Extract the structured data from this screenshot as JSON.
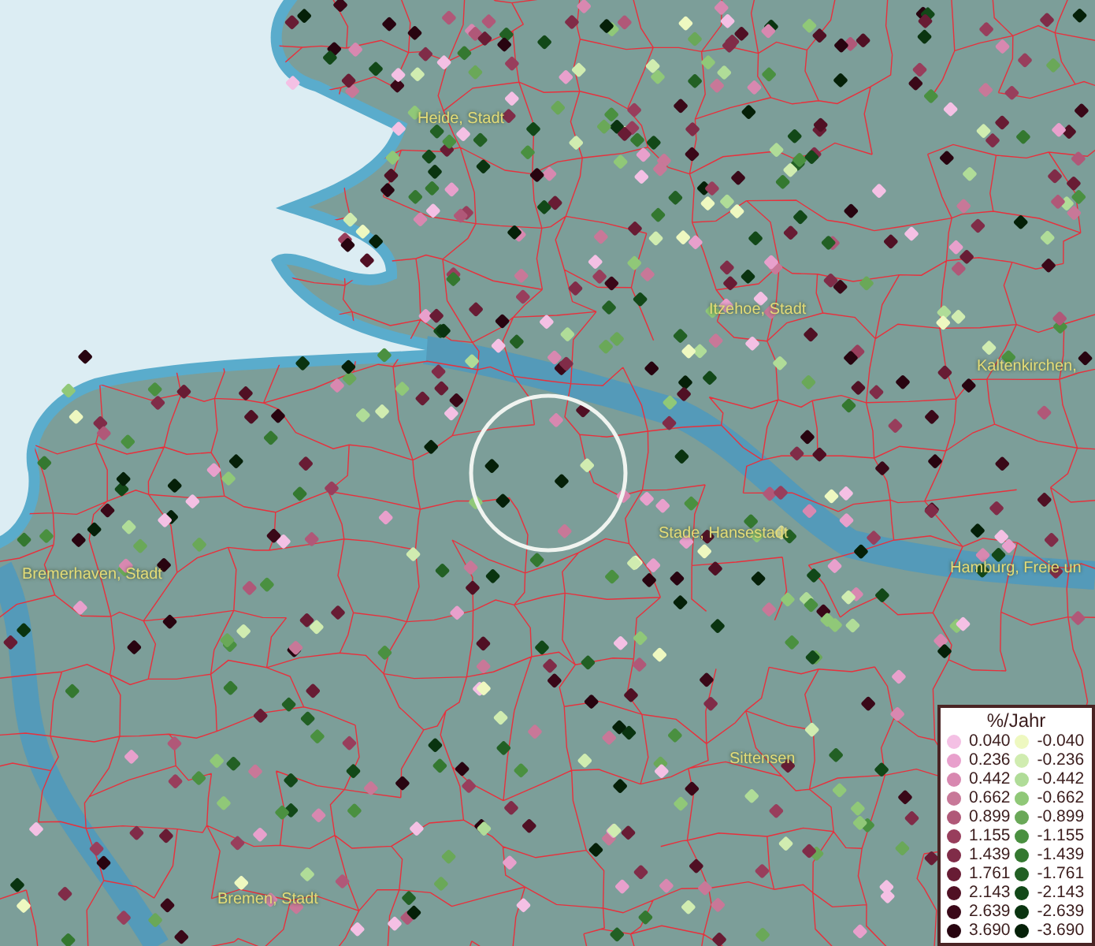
{
  "map": {
    "place_labels": [
      {
        "text": "Heide, Stadt"
      },
      {
        "text": "Itzehoe, Stadt"
      },
      {
        "text": "Kaltenkirchen,"
      },
      {
        "text": "Stade, Hansestadt"
      },
      {
        "text": "Bremerhaven, Stadt"
      },
      {
        "text": "Hamburg, Freie un"
      },
      {
        "text": "Sittensen"
      },
      {
        "text": "Bremen, Stadt"
      }
    ]
  },
  "legend": {
    "title": "%/Jahr",
    "positive": [
      {
        "value": "0.040",
        "color": "#f4c0e4"
      },
      {
        "value": "0.236",
        "color": "#e8a0cc"
      },
      {
        "value": "0.442",
        "color": "#d888b0"
      },
      {
        "value": "0.662",
        "color": "#c87898"
      },
      {
        "value": "0.899",
        "color": "#b05878"
      },
      {
        "value": "1.155",
        "color": "#983e5c"
      },
      {
        "value": "1.439",
        "color": "#802c48"
      },
      {
        "value": "1.761",
        "color": "#681c34"
      },
      {
        "value": "2.143",
        "color": "#501024"
      },
      {
        "value": "2.639",
        "color": "#3a0818"
      },
      {
        "value": "3.690",
        "color": "#280410"
      }
    ],
    "negative": [
      {
        "value": "-0.040",
        "color": "#eef8c0"
      },
      {
        "value": "-0.236",
        "color": "#d0ecb0"
      },
      {
        "value": "-0.442",
        "color": "#b0dc98"
      },
      {
        "value": "-0.662",
        "color": "#90c878"
      },
      {
        "value": "-0.899",
        "color": "#6aa858"
      },
      {
        "value": "-1.155",
        "color": "#4a9040"
      },
      {
        "value": "-1.439",
        "color": "#347830"
      },
      {
        "value": "-1.761",
        "color": "#226024"
      },
      {
        "value": "-2.143",
        "color": "#124818"
      },
      {
        "value": "-2.639",
        "color": "#0a3410"
      },
      {
        "value": "-3.690",
        "color": "#052008"
      }
    ]
  }
}
